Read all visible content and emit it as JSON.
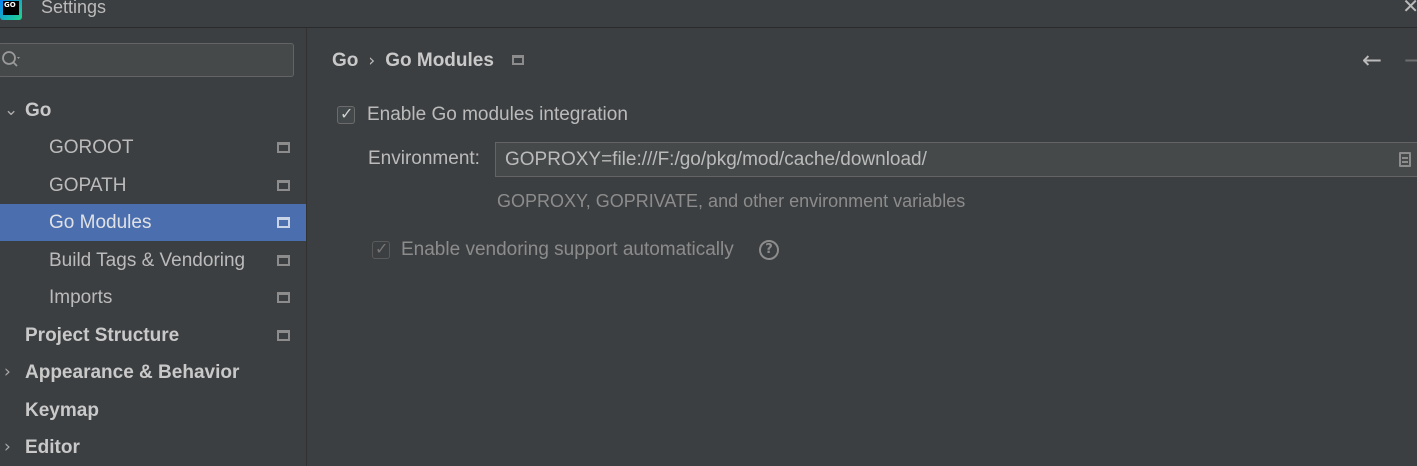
{
  "window": {
    "title": "Settings",
    "logo_text": "GO"
  },
  "sidebar": {
    "search": {
      "value": "",
      "placeholder": ""
    },
    "items": [
      {
        "label": "Go",
        "expanded": true
      },
      {
        "label": "GOROOT"
      },
      {
        "label": "GOPATH"
      },
      {
        "label": "Go Modules",
        "selected": true
      },
      {
        "label": "Build Tags & Vendoring"
      },
      {
        "label": "Imports"
      },
      {
        "label": "Project Structure"
      },
      {
        "label": "Appearance & Behavior",
        "expanded": false
      },
      {
        "label": "Keymap"
      },
      {
        "label": "Editor",
        "expanded": false
      }
    ]
  },
  "main": {
    "breadcrumb": [
      "Go",
      "Go Modules"
    ],
    "breadcrumb_separator": "›",
    "enable_modules": {
      "label": "Enable Go modules integration",
      "checked": true
    },
    "environment": {
      "label": "Environment:",
      "value": "GOPROXY=file:///F:/go/pkg/mod/cache/download/",
      "hint": "GOPROXY, GOPRIVATE, and other environment variables"
    },
    "vendoring": {
      "label": "Enable vendoring support automatically",
      "checked": true,
      "enabled": false
    },
    "help_glyph": "?"
  },
  "icons": {
    "close": "close-icon",
    "back": "back-arrow-icon",
    "forward": "forward-arrow-icon",
    "search": "search-icon",
    "project_level": "project-level-icon"
  },
  "colors": {
    "background": "#3c3f41",
    "selection": "#4b6eaf",
    "text": "#bbbbbb",
    "hint": "#8c8c8c"
  }
}
